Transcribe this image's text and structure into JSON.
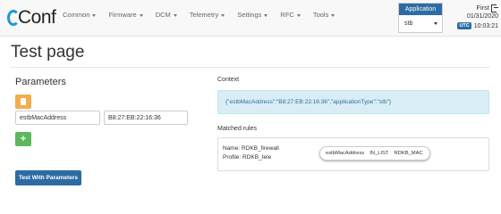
{
  "navbar": {
    "brand": "Conf",
    "menu": [
      {
        "label": "Common"
      },
      {
        "label": "Firmware"
      },
      {
        "label": "DCM"
      },
      {
        "label": "Telemetry"
      },
      {
        "label": "Settings"
      },
      {
        "label": "RFC"
      },
      {
        "label": "Tools"
      }
    ],
    "application": {
      "label": "Application",
      "value": "stb"
    },
    "user": {
      "name": "First",
      "date": "01/31/2020",
      "timezone": "UTC",
      "time": "10:03:21"
    }
  },
  "page": {
    "title": "Test page"
  },
  "parameters": {
    "title": "Parameters",
    "rows": [
      {
        "key": "estbMacAddress",
        "value": "B8:27:EB:22:16:36"
      }
    ],
    "add_button": "+",
    "test_button": "Test With Parameters"
  },
  "context": {
    "label": "Context",
    "value": "{\"estbMacAddress\":\"B8:27:EB:22:16:36\",\"applicationType\":\"stb\"}"
  },
  "matched_rules": {
    "label": "Matched rules",
    "items": [
      {
        "name": "Name: RDKB_firewall",
        "profile": "Profile: RDKB_tele",
        "condition": {
          "key": "estbMacAddress",
          "operation": "IN_LIST",
          "value": "RDKB_MAC"
        }
      }
    ]
  },
  "colors": {
    "primary": "#2d6ca2",
    "brand_accent": "#1a9bd7",
    "warning": "#f0ad4e",
    "success": "#5cb85c",
    "info_bg": "#d9edf7"
  },
  "icons": {
    "clear": "file-icon",
    "signout": "sign-out-icon"
  }
}
